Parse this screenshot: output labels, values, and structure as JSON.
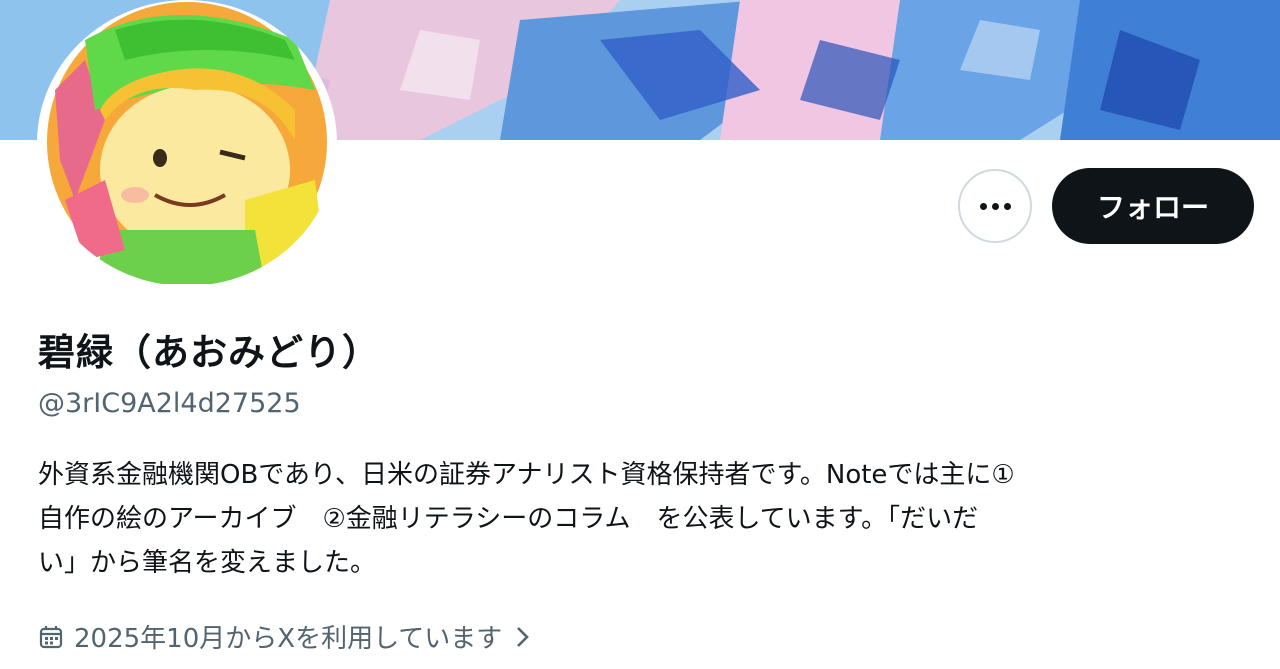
{
  "profile": {
    "display_name": "碧緑（あおみどり）",
    "handle": "@3rIC9A2l4d27525",
    "bio_lines": [
      "外資系金融機関OBであり、日米の証券アナリスト資格保持者です。Noteでは主に①",
      "自作の絵のアーカイブ　②金融リテラシーのコラム　を公表しています。「だいだ",
      "い」から筆名を変えました。"
    ],
    "joined": "2025年10月からXを利用しています"
  },
  "actions": {
    "follow_label": "フォロー",
    "more_icon": "more-dots-icon"
  },
  "icons": {
    "joined_icon": "calendar-icon",
    "joined_arrow": "chevron-right-icon"
  },
  "colors": {
    "primary_text": "#0f1419",
    "secondary_text": "#536471",
    "button_bg": "#0f1419",
    "button_text": "#ffffff",
    "border": "#cfd9de"
  }
}
